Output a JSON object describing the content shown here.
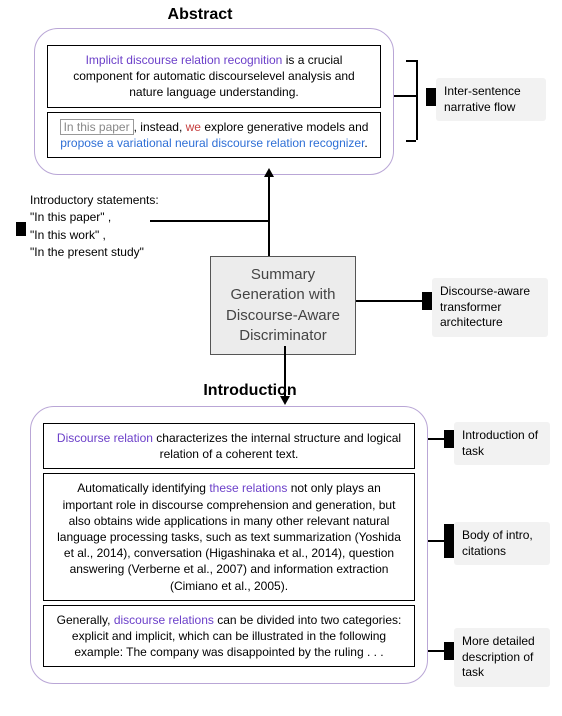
{
  "titles": {
    "abstract": "Abstract",
    "introduction": "Introduction"
  },
  "abstract": {
    "box1": {
      "pre": "",
      "hl1": "Implicit discourse relation recognition",
      "mid": " is a crucial component for automatic discourselevel analysis and nature language understanding."
    },
    "box2": {
      "boxed": "In this paper",
      "mid": ", instead, ",
      "hl_red": "we",
      "mid2": " explore generative models and ",
      "hl_blue": "propose a variational neural discourse relation recognizer",
      "tail": "."
    }
  },
  "intro_statements": {
    "heading": "Introductory statements:",
    "line1": "\"In this paper\" ,",
    "line2": "\"In this work\" ,",
    "line3": "\"In the present study\""
  },
  "model_box": {
    "l1": "Summary",
    "l2": "Generation with",
    "l3": "Discourse-Aware",
    "l4": "Discriminator"
  },
  "annotations": {
    "inter_sentence": "Inter-sentence narrative flow",
    "disc_arch": "Discourse-aware transformer architecture",
    "intro_task": "Introduction of task",
    "body_intro": "Body of intro, citations",
    "more_detail": "More detailed description of task"
  },
  "introduction": {
    "box1": {
      "hl1": "Discourse relation",
      "rest": " characterizes the internal structure and logical relation of a coherent text."
    },
    "box2": {
      "pre": "Automatically identifying ",
      "hl1": "these relations",
      "rest": " not only plays an important role in discourse comprehension and generation, but also obtains wide applications in many other relevant natural language processing tasks, such as text summarization (Yoshida et al., 2014), conversation (Higashinaka et al., 2014), question answering (Verberne et al., 2007) and information extraction (Cimiano et al., 2005)."
    },
    "box3": {
      "pre": "Generally, ",
      "hl1": "discourse relations",
      "rest": " can be divided into two categories: explicit and implicit, which can be illustrated in the following example: The company was disappointed by the ruling . . ."
    }
  }
}
